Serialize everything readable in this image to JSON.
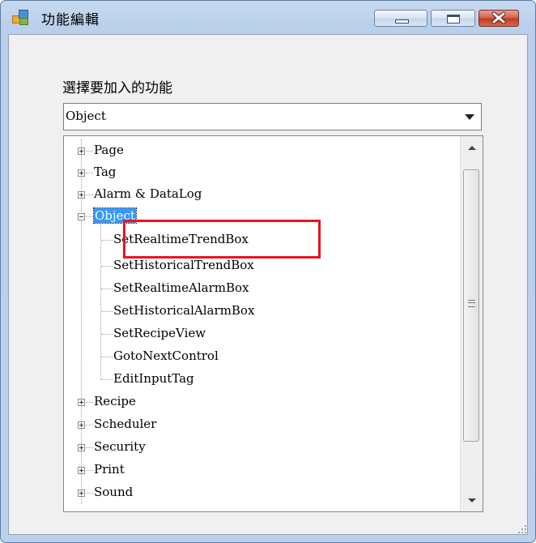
{
  "window": {
    "title": "功能編輯"
  },
  "prompt": "選擇要加入的功能",
  "combo": {
    "value": "Object"
  },
  "tree": {
    "before": [
      "Page",
      "Tag",
      "Alarm & DataLog"
    ],
    "expanded": "Object",
    "children": [
      "SetRealtimeTrendBox",
      "SetHistoricalTrendBox",
      "SetRealtimeAlarmBox",
      "SetHistoricalAlarmBox",
      "SetRecipeView",
      "GotoNextControl",
      "EditInputTag"
    ],
    "after": [
      "Recipe",
      "Scheduler",
      "Security",
      "Print",
      "Sound"
    ]
  },
  "colors": {
    "highlight": "#e8141e",
    "selection": "#3399ff"
  },
  "icons": [
    "app-icon",
    "minimize-icon",
    "maximize-icon",
    "close-icon",
    "expand-icon",
    "collapse-icon",
    "scroll-up-icon",
    "scroll-down-icon",
    "resize-grip-icon"
  ]
}
